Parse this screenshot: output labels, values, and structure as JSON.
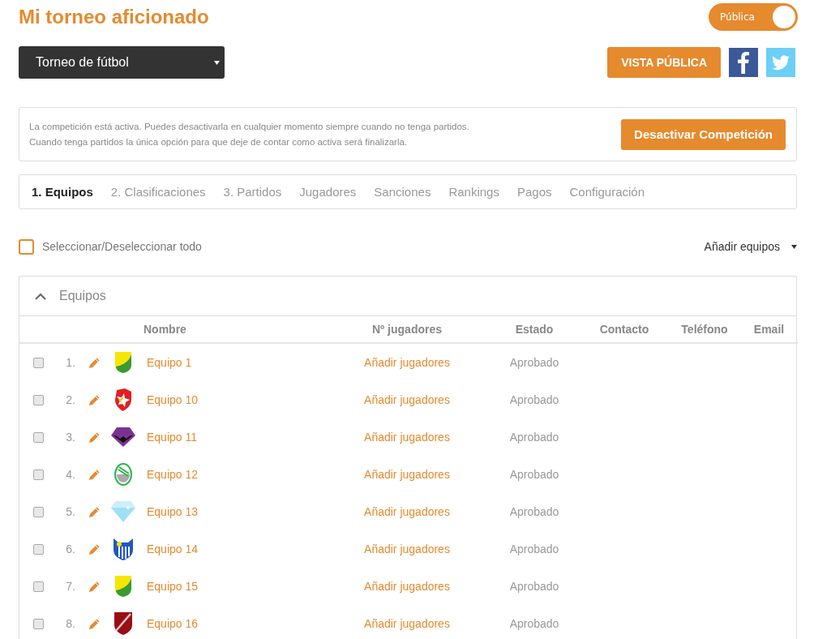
{
  "header": {
    "title": "Mi torneo aficionado",
    "visibility_toggle": {
      "label": "Pública",
      "on": true
    }
  },
  "competition_select": {
    "value": "Torneo de fútbol"
  },
  "actions": {
    "public_view": "VISTA PÚBLICA"
  },
  "notice": {
    "lines": [
      "La competición está activa. Puedes desactivarla en cualquier momento siempre cuando no tenga partidos.",
      "Cuando tenga partidos la única opción para que deje de contar como activa será finalizarla."
    ],
    "button": "Desactivar Competición"
  },
  "tabs": [
    {
      "label": "1. Equipos",
      "selected": true
    },
    {
      "label": "2. Clasificaciones",
      "selected": false
    },
    {
      "label": "3. Partidos",
      "selected": false
    },
    {
      "label": "Jugadores",
      "selected": false
    },
    {
      "label": "Sanciones",
      "selected": false
    },
    {
      "label": "Rankings",
      "selected": false
    },
    {
      "label": "Pagos",
      "selected": false
    },
    {
      "label": "Configuración",
      "selected": false
    }
  ],
  "select_all": {
    "label": "Seleccionar/Deseleccionar todo",
    "checked": false
  },
  "add_teams": "Añadir equipos",
  "panel": {
    "title": "Equipos",
    "expanded": true
  },
  "table": {
    "columns": [
      "Nombre",
      "Nº jugadores",
      "Estado",
      "Contacto",
      "Teléfono",
      "Email"
    ],
    "rows": [
      {
        "index": "1.",
        "checked": false,
        "kind": "half",
        "name": "Equipo 1",
        "players": "Añadir jugadores",
        "status": "Aprobado"
      },
      {
        "index": "2.",
        "checked": false,
        "kind": "star",
        "name": "Equipo 10",
        "players": "Añadir jugadores",
        "status": "Aprobado"
      },
      {
        "index": "3.",
        "checked": false,
        "kind": "bat",
        "name": "Equipo 11",
        "players": "Añadir jugadores",
        "status": "Aprobado"
      },
      {
        "index": "4.",
        "checked": false,
        "kind": "oval",
        "name": "Equipo 12",
        "players": "Añadir jugadores",
        "status": "Aprobado"
      },
      {
        "index": "5.",
        "checked": false,
        "kind": "diamond",
        "name": "Equipo 13",
        "players": "Añadir jugadores",
        "status": "Aprobado"
      },
      {
        "index": "6.",
        "checked": false,
        "kind": "stripes",
        "name": "Equipo 14",
        "players": "Añadir jugadores",
        "status": "Aprobado"
      },
      {
        "index": "7.",
        "checked": false,
        "kind": "half",
        "name": "Equipo 15",
        "players": "Añadir jugadores",
        "status": "Aprobado"
      },
      {
        "index": "8.",
        "checked": false,
        "kind": "sash",
        "name": "Equipo 16",
        "players": "Añadir jugadores",
        "status": "Aprobado"
      }
    ]
  }
}
